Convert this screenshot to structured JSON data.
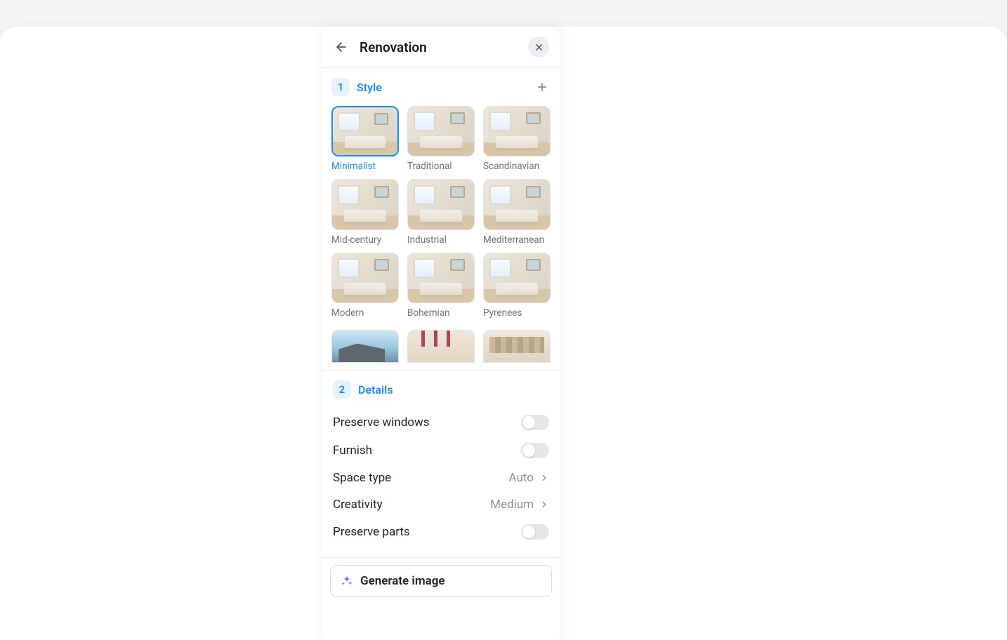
{
  "panel": {
    "title": "Renovation"
  },
  "style_section": {
    "step_number": "1",
    "label": "Style",
    "styles": [
      {
        "label": "Minimalist",
        "selected": true
      },
      {
        "label": "Traditional",
        "selected": false
      },
      {
        "label": "Scandinavian",
        "selected": false
      },
      {
        "label": "Mid-century",
        "selected": false
      },
      {
        "label": "Industrial",
        "selected": false
      },
      {
        "label": "Mediterranean",
        "selected": false
      },
      {
        "label": "Modern",
        "selected": false
      },
      {
        "label": "Bohemian",
        "selected": false
      },
      {
        "label": "Pyrenees",
        "selected": false
      }
    ]
  },
  "details_section": {
    "step_number": "2",
    "label": "Details",
    "preserve_windows": {
      "label": "Preserve windows",
      "value": false
    },
    "furnish": {
      "label": "Furnish",
      "value": false
    },
    "space_type": {
      "label": "Space type",
      "value": "Auto"
    },
    "creativity": {
      "label": "Creativity",
      "value": "Medium"
    },
    "preserve_parts": {
      "label": "Preserve parts",
      "value": false
    }
  },
  "generate": {
    "label": "Generate image"
  }
}
